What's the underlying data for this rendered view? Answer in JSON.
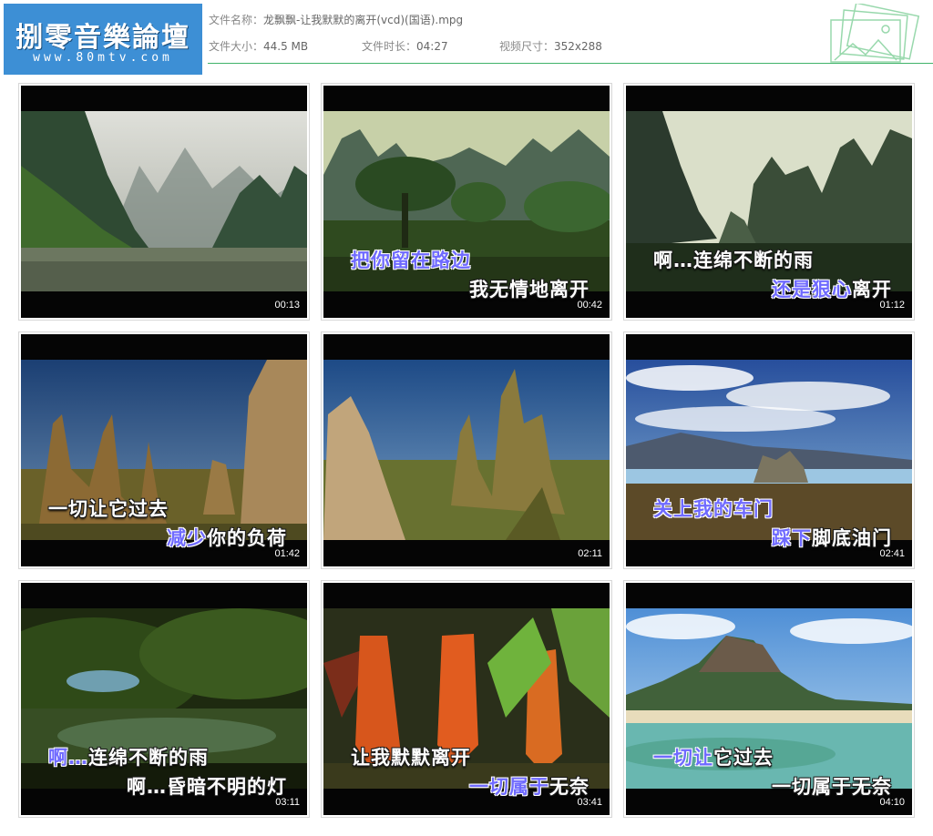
{
  "header": {
    "logo_title": "捌零音樂論壇",
    "logo_url": "www.80mtv.com",
    "file_name_label": "文件名称：",
    "file_name": "龙飘飘-让我默默的离开(vcd)(国语).mpg",
    "file_size_label": "文件大小：",
    "file_size": "44.5 MB",
    "duration_label": "文件时长：",
    "duration": "04:27",
    "resolution_label": "视频尺寸：",
    "resolution": "352x288",
    "accent_color": "#40b36a",
    "logo_color": "#3d8fd5"
  },
  "thumbnails": [
    {
      "time": "00:13",
      "line1": "",
      "line1_hl": "",
      "line2": "",
      "line2_hl": "",
      "scene": "river-karst"
    },
    {
      "time": "00:42",
      "line1": "",
      "line1_hl": "把你留在路边",
      "line2": "我无情地离开",
      "line2_hl": "",
      "scene": "trees-karst"
    },
    {
      "time": "01:12",
      "line1": "啊…连绵不断的雨",
      "line1_hl": "",
      "line2": "离开",
      "line2_hl": "还是狠心",
      "scene": "karst-peaks"
    },
    {
      "time": "01:42",
      "line1": "一切让它过去",
      "line1_hl": "",
      "line2": "你的负荷",
      "line2_hl": "减少",
      "scene": "rock-pinnacles"
    },
    {
      "time": "02:11",
      "line1": "",
      "line1_hl": "",
      "line2": "",
      "line2_hl": "",
      "scene": "tufa-spires"
    },
    {
      "time": "02:41",
      "line1": "",
      "line1_hl": "关上我的车门",
      "line2": "脚底油门",
      "line2_hl": "踩下",
      "scene": "lake-clouds"
    },
    {
      "time": "03:11",
      "line1": "连绵不断的雨",
      "line1_hl": "啊…",
      "line2": "啊…昏暗不明的灯",
      "line2_hl": "",
      "scene": "jungle-pond"
    },
    {
      "time": "03:41",
      "line1": "让我默默离开",
      "line1_hl": "",
      "line2": "无奈",
      "line2_hl": "一切属于",
      "scene": "pitcher-plants"
    },
    {
      "time": "04:10",
      "line1": "它过去",
      "line1_hl": "一切让",
      "line2": "一切属于无奈",
      "line2_hl": "",
      "scene": "tropical-beach"
    }
  ]
}
